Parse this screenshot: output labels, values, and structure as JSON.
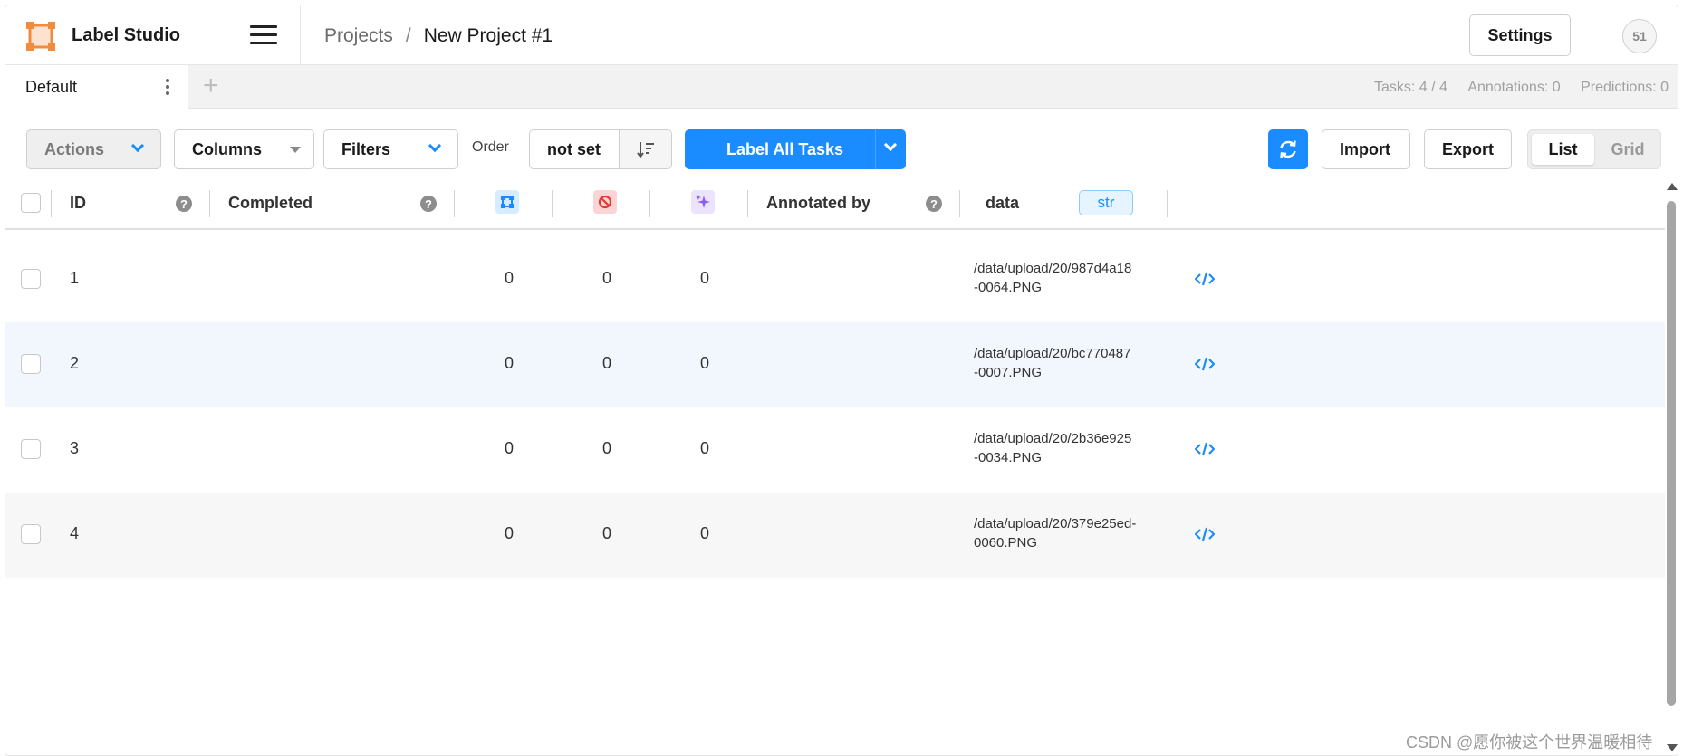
{
  "header": {
    "app_title": "Label Studio",
    "breadcrumb": {
      "projects": "Projects",
      "separator": "/",
      "current": "New Project #1"
    },
    "settings_label": "Settings",
    "avatar_initials": "51"
  },
  "tabs": {
    "items": [
      {
        "label": "Default"
      }
    ],
    "add_label": "+",
    "counts": {
      "tasks": "Tasks: 4 / 4",
      "annotations": "Annotations: 0",
      "predictions": "Predictions: 0"
    }
  },
  "toolbar": {
    "actions_label": "Actions",
    "columns_label": "Columns",
    "filters_label": "Filters",
    "order_label": "Order",
    "order_value": "not set",
    "label_all_label": "Label All Tasks",
    "import_label": "Import",
    "export_label": "Export",
    "view": {
      "list_label": "List",
      "grid_label": "Grid",
      "selected": "List"
    }
  },
  "table": {
    "columns": {
      "id": "ID",
      "completed": "Completed",
      "total_annotations_icon": "annotations-icon",
      "cancelled_icon": "cancelled-icon",
      "predictions_icon": "predictions-icon",
      "annotated_by": "Annotated by",
      "data": "data",
      "data_type": "str",
      "help_mark": "?"
    },
    "rows": [
      {
        "id": "1",
        "annotations": "0",
        "cancelled": "0",
        "predictions": "0",
        "path_line1": "/data/upload/20/987d4a18",
        "path_line2": "-0064.PNG"
      },
      {
        "id": "2",
        "annotations": "0",
        "cancelled": "0",
        "predictions": "0",
        "path_line1": "/data/upload/20/bc770487",
        "path_line2": "-0007.PNG"
      },
      {
        "id": "3",
        "annotations": "0",
        "cancelled": "0",
        "predictions": "0",
        "path_line1": "/data/upload/20/2b36e925",
        "path_line2": "-0034.PNG"
      },
      {
        "id": "4",
        "annotations": "0",
        "cancelled": "0",
        "predictions": "0",
        "path_line1": "/data/upload/20/379e25ed-",
        "path_line2": "0060.PNG"
      }
    ]
  },
  "colors": {
    "accent": "#1a8cff",
    "logo": "#f28b3c",
    "row_highlight": "#f2f7fd",
    "cancelled_icon_bg": "#fbd5d5",
    "predictions_icon_bg": "#ece3ff"
  },
  "watermark": "CSDN @愿你被这个世界温暖相待"
}
